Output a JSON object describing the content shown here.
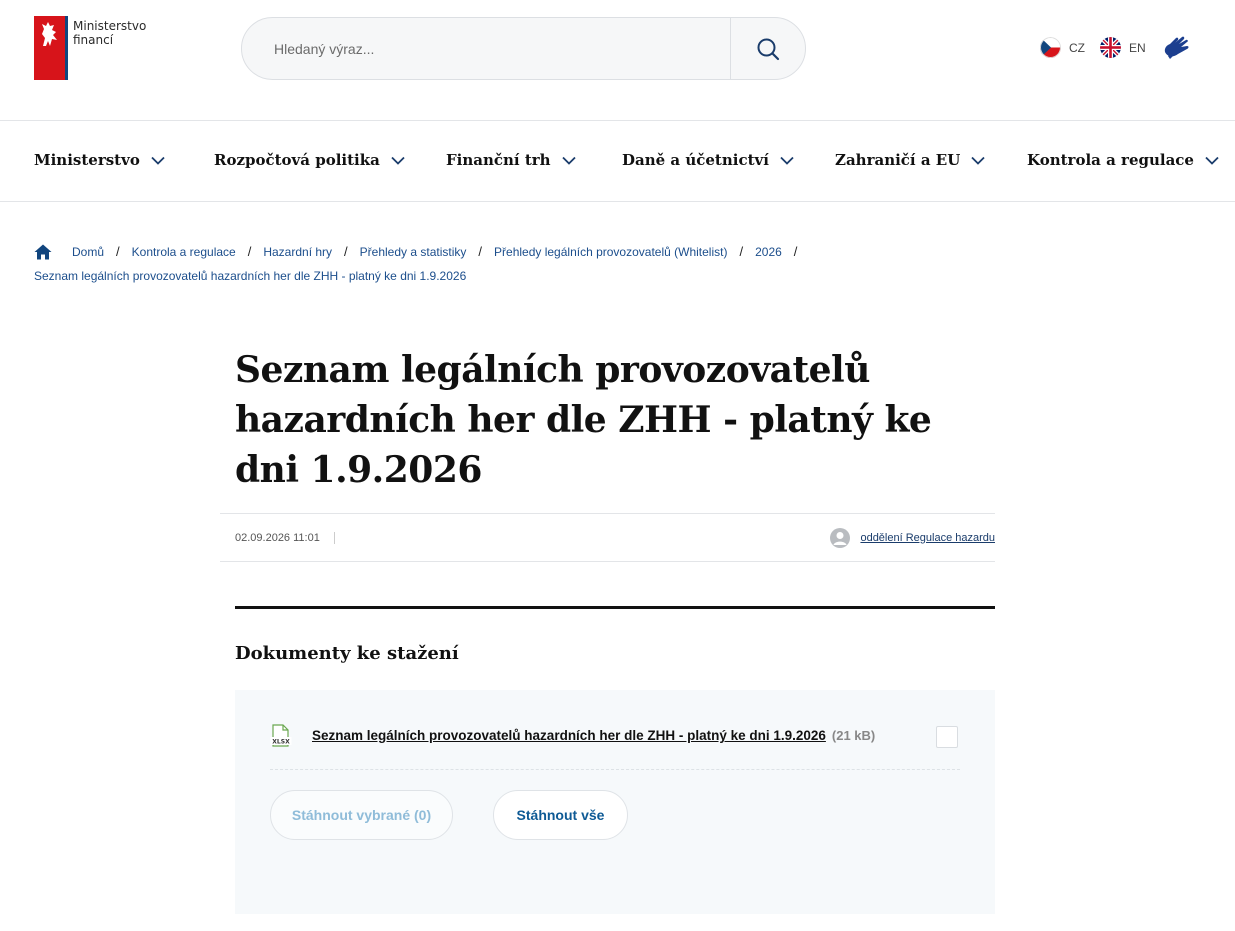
{
  "header": {
    "logo_line1": "Ministerstvo",
    "logo_line2": "financí",
    "search_placeholder": "Hledaný výraz...",
    "lang_cz": "CZ",
    "lang_en": "EN"
  },
  "nav": {
    "items": [
      {
        "label": "Ministerstvo"
      },
      {
        "label": "Rozpočtová politika"
      },
      {
        "label": "Finanční trh"
      },
      {
        "label": "Daně a účetnictví"
      },
      {
        "label": "Zahraničí a EU"
      },
      {
        "label": "Kontrola a regulace"
      }
    ]
  },
  "breadcrumb": {
    "items": [
      {
        "label": "Domů"
      },
      {
        "label": "Kontrola a regulace"
      },
      {
        "label": "Hazardní hry"
      },
      {
        "label": "Přehledy a statistiky"
      },
      {
        "label": "Přehledy legálních provozovatelů (Whitelist)"
      },
      {
        "label": "2026"
      }
    ],
    "current": "Seznam legálních provozovatelů hazardních her dle ZHH - platný ke dni 1.9.2026"
  },
  "article": {
    "title": "Seznam legálních provozovatelů hazardních her dle ZHH - platný ke dni 1.9.2026",
    "date": "02.09.2026 11:01",
    "author": "oddělení Regulace hazardu"
  },
  "documents": {
    "heading": "Dokumenty ke stažení",
    "items": [
      {
        "file_type": "XLSX",
        "label": "Seznam legálních provozovatelů hazardních her dle ZHH - platný ke dni 1.9.2026",
        "size": "(21 kB)"
      }
    ],
    "download_selected": "Stáhnout vybrané (0)",
    "download_all": "Stáhnout vše"
  },
  "colors": {
    "brand_red": "#d7141a",
    "brand_blue": "#11457e",
    "link_blue": "#1c4e8c"
  }
}
